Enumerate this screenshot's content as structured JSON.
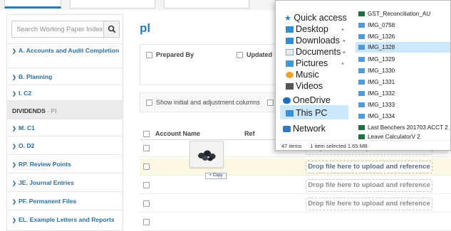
{
  "sidebar": {
    "search_placeholder": "Search Working Paper Index",
    "items": [
      {
        "label": "A. Accounts and Audit Completion",
        "chevron": "down"
      },
      {
        "label": "B. Planning",
        "chevron": "down"
      },
      {
        "label": "I. C2",
        "chevron": "up"
      },
      {
        "label": "DIVIDENDS",
        "suffix": "- PI",
        "selected": true
      },
      {
        "label": "M. C1",
        "chevron": "down"
      },
      {
        "label": "O. D2",
        "chevron": "down"
      },
      {
        "label": "RP. Review Points",
        "chevron": "down"
      },
      {
        "label": "JE. Journal Entries",
        "chevron": "down"
      },
      {
        "label": "PF. Permanent Files",
        "chevron": "down"
      },
      {
        "label": "EL. Example Letters and Reports",
        "chevron": "down"
      }
    ]
  },
  "main": {
    "title": "pl",
    "filters": {
      "prepared_by": "Prepared By",
      "updated": "Updated"
    },
    "options": {
      "show_initial": "Show initial and adjustment columns"
    },
    "table": {
      "columns": [
        "Account Name",
        "Ref"
      ],
      "dropzone_label": "Drop file here to upload and reference",
      "row_count": 5
    }
  },
  "drag": {
    "copy_label": "+ Copy"
  },
  "explorer": {
    "nav": {
      "quick_access": "Quick access",
      "desktop": "Desktop",
      "downloads": "Downloads",
      "documents": "Documents",
      "pictures": "Pictures",
      "music": "Music",
      "videos": "Videos",
      "onedrive": "OneDrive",
      "this_pc": "This PC",
      "network": "Network"
    },
    "files": [
      "GST_Reconciliation_AU",
      "IMG_0758",
      "IMG_1326",
      "IMG_1328",
      "IMG_1329",
      "IMG_1330",
      "IMG_1331",
      "IMG_1332",
      "IMG_1333",
      "IMG_1334",
      "Last Benchers 201703 ACCT 2",
      "Leave CalculatorV 2"
    ],
    "selected_file": "IMG_1328",
    "status": {
      "items": "47 items",
      "selection": "1 item selected  1.65 MB"
    }
  },
  "colors": {
    "accent": "#1f7fc5",
    "nav_link": "#2a6f9d",
    "highlight_row": "#fcf8e3",
    "explorer_selection": "#cce8ff"
  }
}
